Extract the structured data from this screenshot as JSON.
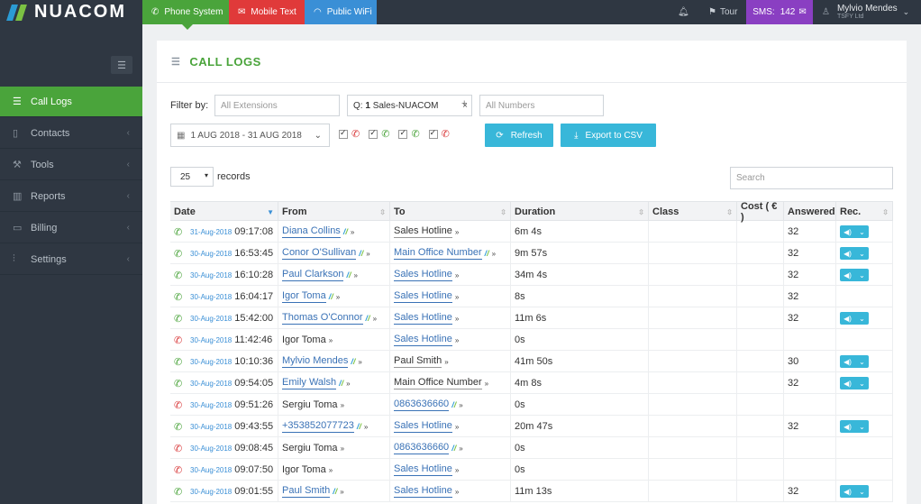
{
  "brand": {
    "name": "NUACOM"
  },
  "top_tabs": [
    {
      "label": "Phone System",
      "icon": "phone-icon"
    },
    {
      "label": "Mobile Text",
      "icon": "envelope-icon"
    },
    {
      "label": "Public WiFi",
      "icon": "wifi-icon"
    }
  ],
  "top_right": {
    "tour_label": "Tour",
    "sms_label": "SMS:",
    "sms_count": "142",
    "user_name": "Mylvio Mendes",
    "user_company": "TSFY Ltd"
  },
  "sidebar": {
    "items": [
      {
        "label": "Call Logs",
        "icon": "list-icon",
        "active": true
      },
      {
        "label": "Contacts",
        "icon": "book-icon"
      },
      {
        "label": "Tools",
        "icon": "wrench-icon"
      },
      {
        "label": "Reports",
        "icon": "bar-chart-icon"
      },
      {
        "label": "Billing",
        "icon": "card-icon"
      },
      {
        "label": "Settings",
        "icon": "sliders-icon"
      }
    ]
  },
  "page": {
    "title": "CALL LOGS",
    "filter_label": "Filter by:",
    "extensions_placeholder": "All Extensions",
    "queue_prefix": "Q:",
    "queue_count": "1",
    "queue_value": "Sales-NUACOM",
    "numbers_placeholder": "All Numbers",
    "date_range": "1 AUG 2018 - 31 AUG 2018",
    "refresh_label": "Refresh",
    "export_label": "Export to CSV",
    "records_value": "25",
    "records_label": "records",
    "search_placeholder": "Search"
  },
  "table": {
    "headers": [
      "Date",
      "From",
      "To",
      "Duration",
      "Class",
      "Cost ( € )",
      "Answered",
      "Rec."
    ],
    "rows": [
      {
        "type": "in",
        "date": "31-Aug-2018",
        "time": "09:17:08",
        "from": "Diana Collins",
        "from_link": true,
        "from_n": true,
        "to": "Sales Hotline",
        "to_link": false,
        "to_n": false,
        "duration": "6m 4s",
        "answered": "32",
        "rec": true
      },
      {
        "type": "in",
        "date": "30-Aug-2018",
        "time": "16:53:45",
        "from": "Conor O'Sullivan",
        "from_link": true,
        "from_n": true,
        "to": "Main Office Number",
        "to_link": true,
        "to_n": true,
        "duration": "9m 57s",
        "answered": "32",
        "rec": true
      },
      {
        "type": "in",
        "date": "30-Aug-2018",
        "time": "16:10:28",
        "from": "Paul Clarkson",
        "from_link": true,
        "from_n": true,
        "to": "Sales Hotline",
        "to_link": true,
        "to_n": false,
        "duration": "34m 4s",
        "answered": "32",
        "rec": true
      },
      {
        "type": "in",
        "date": "30-Aug-2018",
        "time": "16:04:17",
        "from": "Igor Toma",
        "from_link": true,
        "from_n": true,
        "to": "Sales Hotline",
        "to_link": true,
        "to_n": false,
        "duration": "8s",
        "answered": "32",
        "rec": false
      },
      {
        "type": "in",
        "date": "30-Aug-2018",
        "time": "15:42:00",
        "from": "Thomas O'Connor",
        "from_link": true,
        "from_n": true,
        "to": "Sales Hotline",
        "to_link": true,
        "to_n": false,
        "duration": "11m 6s",
        "answered": "32",
        "rec": true
      },
      {
        "type": "out",
        "date": "30-Aug-2018",
        "time": "11:42:46",
        "from": "Igor Toma",
        "from_link": false,
        "from_n": false,
        "to": "Sales Hotline",
        "to_link": true,
        "to_n": false,
        "duration": "0s",
        "answered": "",
        "rec": false
      },
      {
        "type": "in",
        "date": "30-Aug-2018",
        "time": "10:10:36",
        "from": "Mylvio Mendes",
        "from_link": true,
        "from_n": true,
        "to": "Paul Smith",
        "to_link": false,
        "to_n": false,
        "duration": "41m 50s",
        "answered": "30",
        "rec": true
      },
      {
        "type": "in",
        "date": "30-Aug-2018",
        "time": "09:54:05",
        "from": "Emily Walsh",
        "from_link": true,
        "from_n": true,
        "to": "Main Office Number",
        "to_link": false,
        "to_n": false,
        "duration": "4m 8s",
        "answered": "32",
        "rec": true
      },
      {
        "type": "out",
        "date": "30-Aug-2018",
        "time": "09:51:26",
        "from": "Sergiu Toma",
        "from_link": false,
        "from_n": false,
        "to": "0863636660",
        "to_link": true,
        "to_n": true,
        "duration": "0s",
        "answered": "",
        "rec": false
      },
      {
        "type": "in",
        "date": "30-Aug-2018",
        "time": "09:43:55",
        "from": "+353852077723",
        "from_link": true,
        "from_n": true,
        "to": "Sales Hotline",
        "to_link": true,
        "to_n": false,
        "duration": "20m 47s",
        "answered": "32",
        "rec": true
      },
      {
        "type": "out",
        "date": "30-Aug-2018",
        "time": "09:08:45",
        "from": "Sergiu Toma",
        "from_link": false,
        "from_n": false,
        "to": "0863636660",
        "to_link": true,
        "to_n": true,
        "duration": "0s",
        "answered": "",
        "rec": false
      },
      {
        "type": "out",
        "date": "30-Aug-2018",
        "time": "09:07:50",
        "from": "Igor Toma",
        "from_link": false,
        "from_n": false,
        "to": "Sales Hotline",
        "to_link": true,
        "to_n": false,
        "duration": "0s",
        "answered": "",
        "rec": false
      },
      {
        "type": "in",
        "date": "30-Aug-2018",
        "time": "09:01:55",
        "from": "Paul Smith",
        "from_link": true,
        "from_n": true,
        "to": "Sales Hotline",
        "to_link": true,
        "to_n": false,
        "duration": "11m 13s",
        "answered": "32",
        "rec": true
      }
    ]
  },
  "colors": {
    "brand_green": "#4aa43b",
    "brand_red": "#e03a3a",
    "brand_blue": "#3a8fd6",
    "sms_purple": "#8a3fc2",
    "action_cyan": "#38b7d9",
    "sidebar_bg": "#2f3742"
  }
}
